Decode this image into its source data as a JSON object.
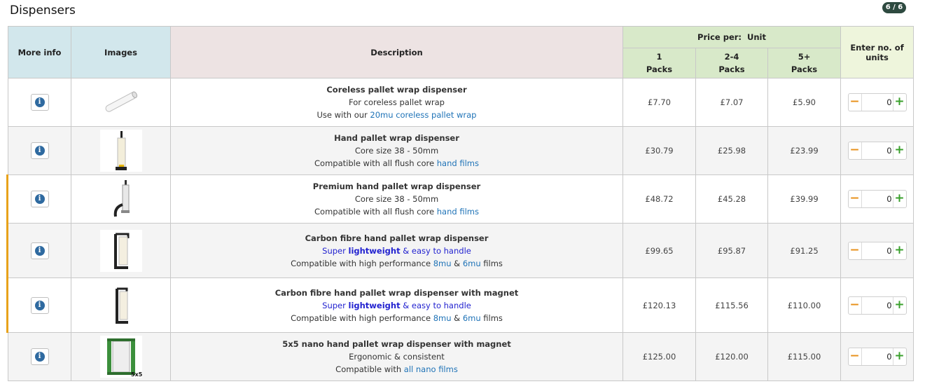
{
  "page": {
    "title": "Dispensers",
    "count": "6 / 6"
  },
  "headers": {
    "more_info": "More info",
    "images": "Images",
    "description": "Description",
    "price_per": "Price per:  Unit",
    "tier1": [
      "1",
      "Packs"
    ],
    "tier2": [
      "2-4",
      "Packs"
    ],
    "tier3": [
      "5+",
      "Packs"
    ],
    "qty": [
      "Enter no. of",
      "units"
    ]
  },
  "products": [
    {
      "name": "Coreless pallet wrap dispenser",
      "line2": "For coreless pallet wrap",
      "line3_pre": "Use with our ",
      "line3_link": "20mu coreless pallet wrap",
      "prices": [
        "£7.70",
        "£7.07",
        "£5.90"
      ],
      "qty": "0"
    },
    {
      "name": "Hand pallet wrap dispenser",
      "line2": "Core size 38 - 50mm",
      "line3_pre": "Compatible with all flush core ",
      "line3_link": "hand films",
      "prices": [
        "£30.79",
        "£25.98",
        "£23.99"
      ],
      "qty": "0"
    },
    {
      "name": "Premium hand pallet wrap dispenser",
      "line2": "Core size 38 - 50mm",
      "line3_pre": "Compatible with all flush core ",
      "line3_link": "hand films",
      "prices": [
        "£48.72",
        "£45.28",
        "£39.99"
      ],
      "qty": "0"
    },
    {
      "name": "Carbon fibre hand pallet wrap dispenser",
      "line2_a": "Super ",
      "line2_b": "lightweight",
      "line2_c": " & easy to handle",
      "line3_pre": "Compatible with high performance ",
      "line3_link1": "8mu",
      "line3_mid": " & ",
      "line3_link2": "6mu",
      "line3_post": " films",
      "prices": [
        "£99.65",
        "£95.87",
        "£91.25"
      ],
      "qty": "0"
    },
    {
      "name": "Carbon fibre hand pallet wrap dispenser with magnet",
      "line2_a": "Super ",
      "line2_b": "lightweight",
      "line2_c": " & easy to handle",
      "line3_pre": "Compatible with high performance ",
      "line3_link1": "8mu",
      "line3_mid": " & ",
      "line3_link2": "6mu",
      "line3_post": " films",
      "prices": [
        "£120.13",
        "£115.56",
        "£110.00"
      ],
      "qty": "0"
    },
    {
      "name": "5x5 nano hand pallet wrap dispenser with magnet",
      "line2": "Ergonomic & consistent",
      "line3_pre": "Compatible with ",
      "line3_link": "all nano films",
      "badge": "5x5",
      "prices": [
        "£125.00",
        "£120.00",
        "£115.00"
      ],
      "qty": "0"
    }
  ],
  "icons": {
    "info": "info-icon",
    "minus": "minus-icon",
    "plus": "plus-icon"
  },
  "colors": {
    "accent": "#e8a21a",
    "link": "#1f73b7",
    "minus": "#e8901a",
    "plus": "#3aa02c",
    "badge": "#2e4a40"
  },
  "symbols": {
    "info": "i",
    "minus": "−",
    "plus": "+"
  }
}
